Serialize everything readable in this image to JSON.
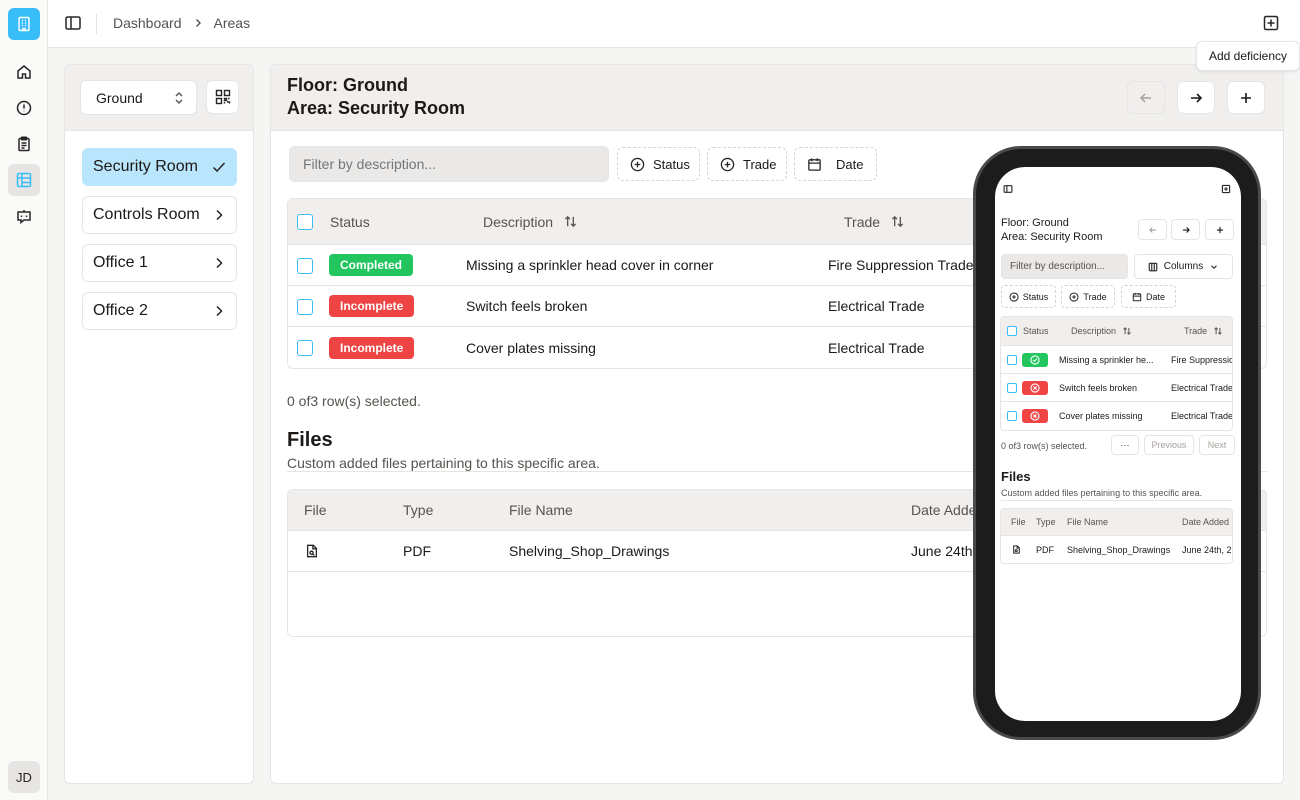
{
  "app": {
    "avatar_initials": "JD"
  },
  "nav": [
    "home-icon",
    "alert-icon",
    "clipboard-icon",
    "areas-icon",
    "bot-icon"
  ],
  "breadcrumb": {
    "items": [
      "Dashboard",
      "Areas"
    ]
  },
  "tooltip": {
    "text": "Add deficiency"
  },
  "sidebar": {
    "floor_select": "Ground",
    "areas": [
      {
        "label": "Security Room",
        "selected": true
      },
      {
        "label": "Controls Room",
        "selected": false
      },
      {
        "label": "Office 1",
        "selected": false
      },
      {
        "label": "Office 2",
        "selected": false
      }
    ]
  },
  "main": {
    "floor_label": "Floor: Ground",
    "area_label": "Area: Security Room",
    "filter_placeholder": "Filter by description...",
    "filters": [
      "Status",
      "Trade",
      "Date"
    ],
    "columns": {
      "status": "Status",
      "description": "Description",
      "trade": "Trade"
    },
    "rows": [
      {
        "status": "Completed",
        "status_color": "#22c55e",
        "description": "Missing a sprinkler head cover in corner",
        "trade": "Fire Suppression Trade"
      },
      {
        "status": "Incomplete",
        "status_color": "#ef4444",
        "description": "Switch feels broken",
        "trade": "Electrical Trade"
      },
      {
        "status": "Incomplete",
        "status_color": "#ef4444",
        "description": "Cover plates missing",
        "trade": "Electrical Trade"
      }
    ],
    "row_selection": "0 of3 row(s) selected.",
    "files": {
      "title": "Files",
      "subtitle": "Custom added files pertaining to this specific area.",
      "columns": {
        "file": "File",
        "type": "Type",
        "name": "File Name",
        "date": "Date Added"
      },
      "rows": [
        {
          "type": "PDF",
          "name": "Shelving_Shop_Drawings",
          "date": "June 24th,"
        }
      ]
    }
  },
  "mobile": {
    "floor_label": "Floor: Ground",
    "area_label": "Area: Security Room",
    "filter_placeholder": "Filter by description...",
    "columns_button": "Columns",
    "filters": [
      "Status",
      "Trade",
      "Date"
    ],
    "columns": {
      "status": "Status",
      "description": "Description",
      "trade": "Trade"
    },
    "rows": [
      {
        "description": "Missing a sprinkler he...",
        "trade": "Fire Suppressio",
        "status_color": "#22c55e"
      },
      {
        "description": "Switch feels broken",
        "trade": "Electrical Trade",
        "status_color": "#ef4444"
      },
      {
        "description": "Cover plates missing",
        "trade": "Electrical Trade",
        "status_color": "#ef4444"
      }
    ],
    "row_selection": "0 of3 row(s) selected.",
    "more": "···",
    "previous": "Previous",
    "next": "Next",
    "files": {
      "title": "Files",
      "subtitle": "Custom added files pertaining to this specific area.",
      "columns": {
        "file": "File",
        "type": "Type",
        "name": "File Name",
        "date": "Date Added"
      },
      "rows": [
        {
          "type": "PDF",
          "name": "Shelving_Shop_Drawings",
          "date": "June 24th, 2"
        }
      ]
    }
  }
}
